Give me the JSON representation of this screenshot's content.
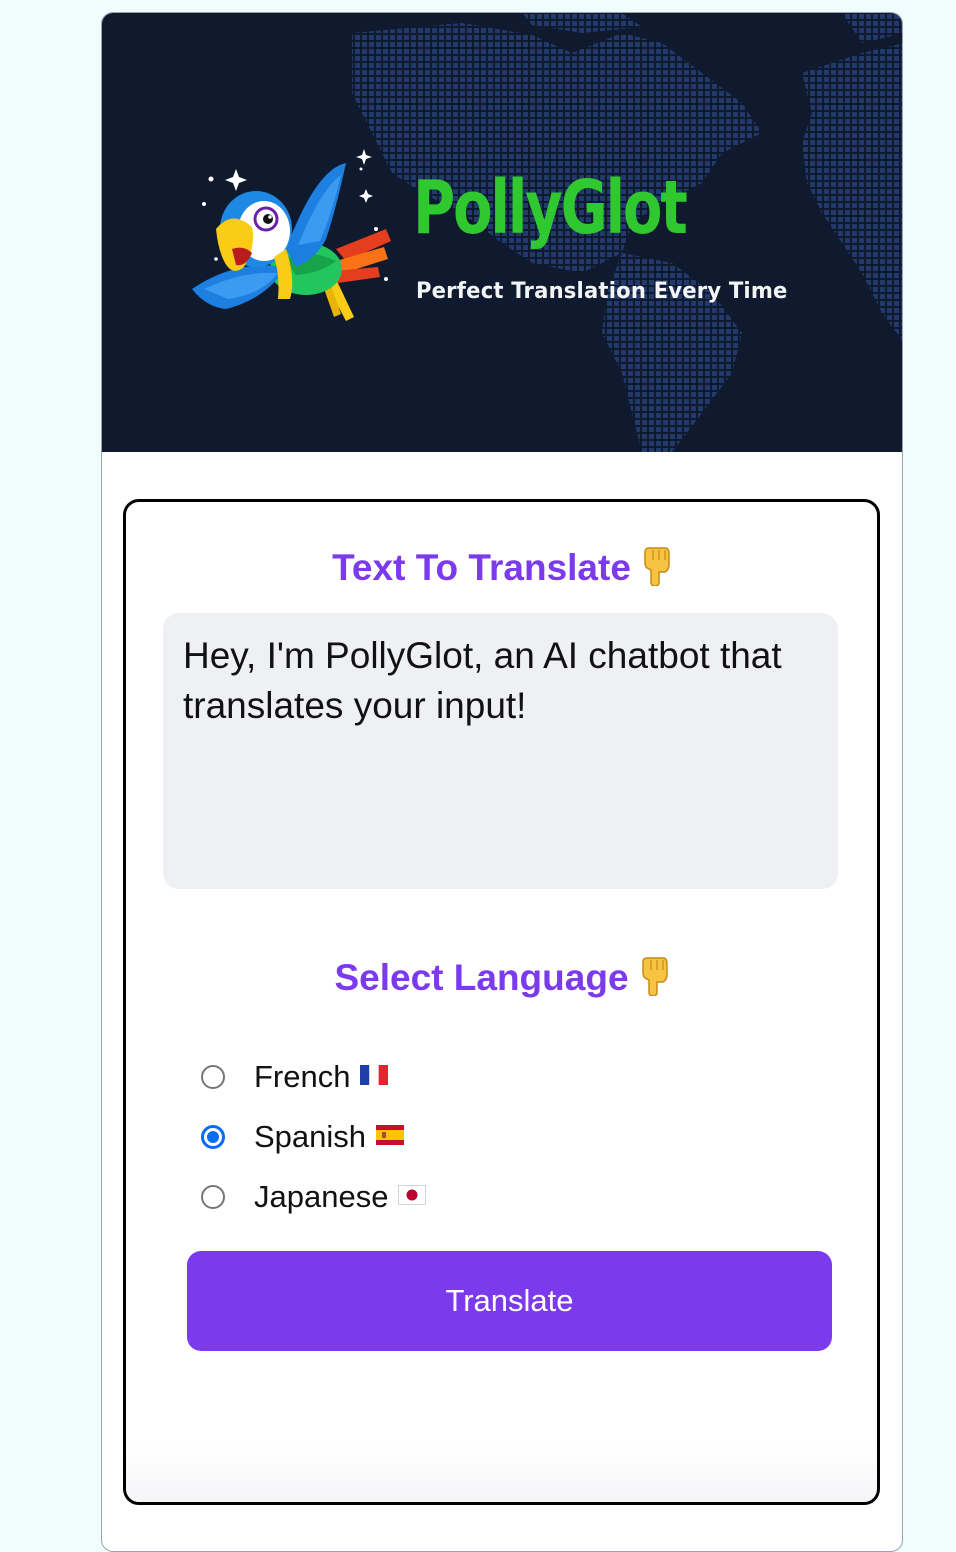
{
  "brand": {
    "name": "PollyGlot",
    "tagline": "Perfect Translation Every Time",
    "logo_icon": "parrot-icon"
  },
  "input_section": {
    "heading": "Text To Translate",
    "heading_icon": "pointing-down-hand-icon",
    "value": "Hey, I'm PollyGlot, an AI chatbot that translates your input!"
  },
  "language_section": {
    "heading": "Select Language",
    "heading_icon": "pointing-down-hand-icon",
    "options": [
      {
        "label": "French",
        "flag": "flag-france-icon",
        "checked": false
      },
      {
        "label": "Spanish",
        "flag": "flag-spain-icon",
        "checked": true
      },
      {
        "label": "Japanese",
        "flag": "flag-japan-icon",
        "checked": false
      }
    ]
  },
  "actions": {
    "translate_label": "Translate"
  },
  "colors": {
    "accent": "#7c3aed",
    "brand_green": "#2fc82f",
    "hero_bg": "#0f1a2e",
    "radio_checked": "#0a6cf0"
  }
}
